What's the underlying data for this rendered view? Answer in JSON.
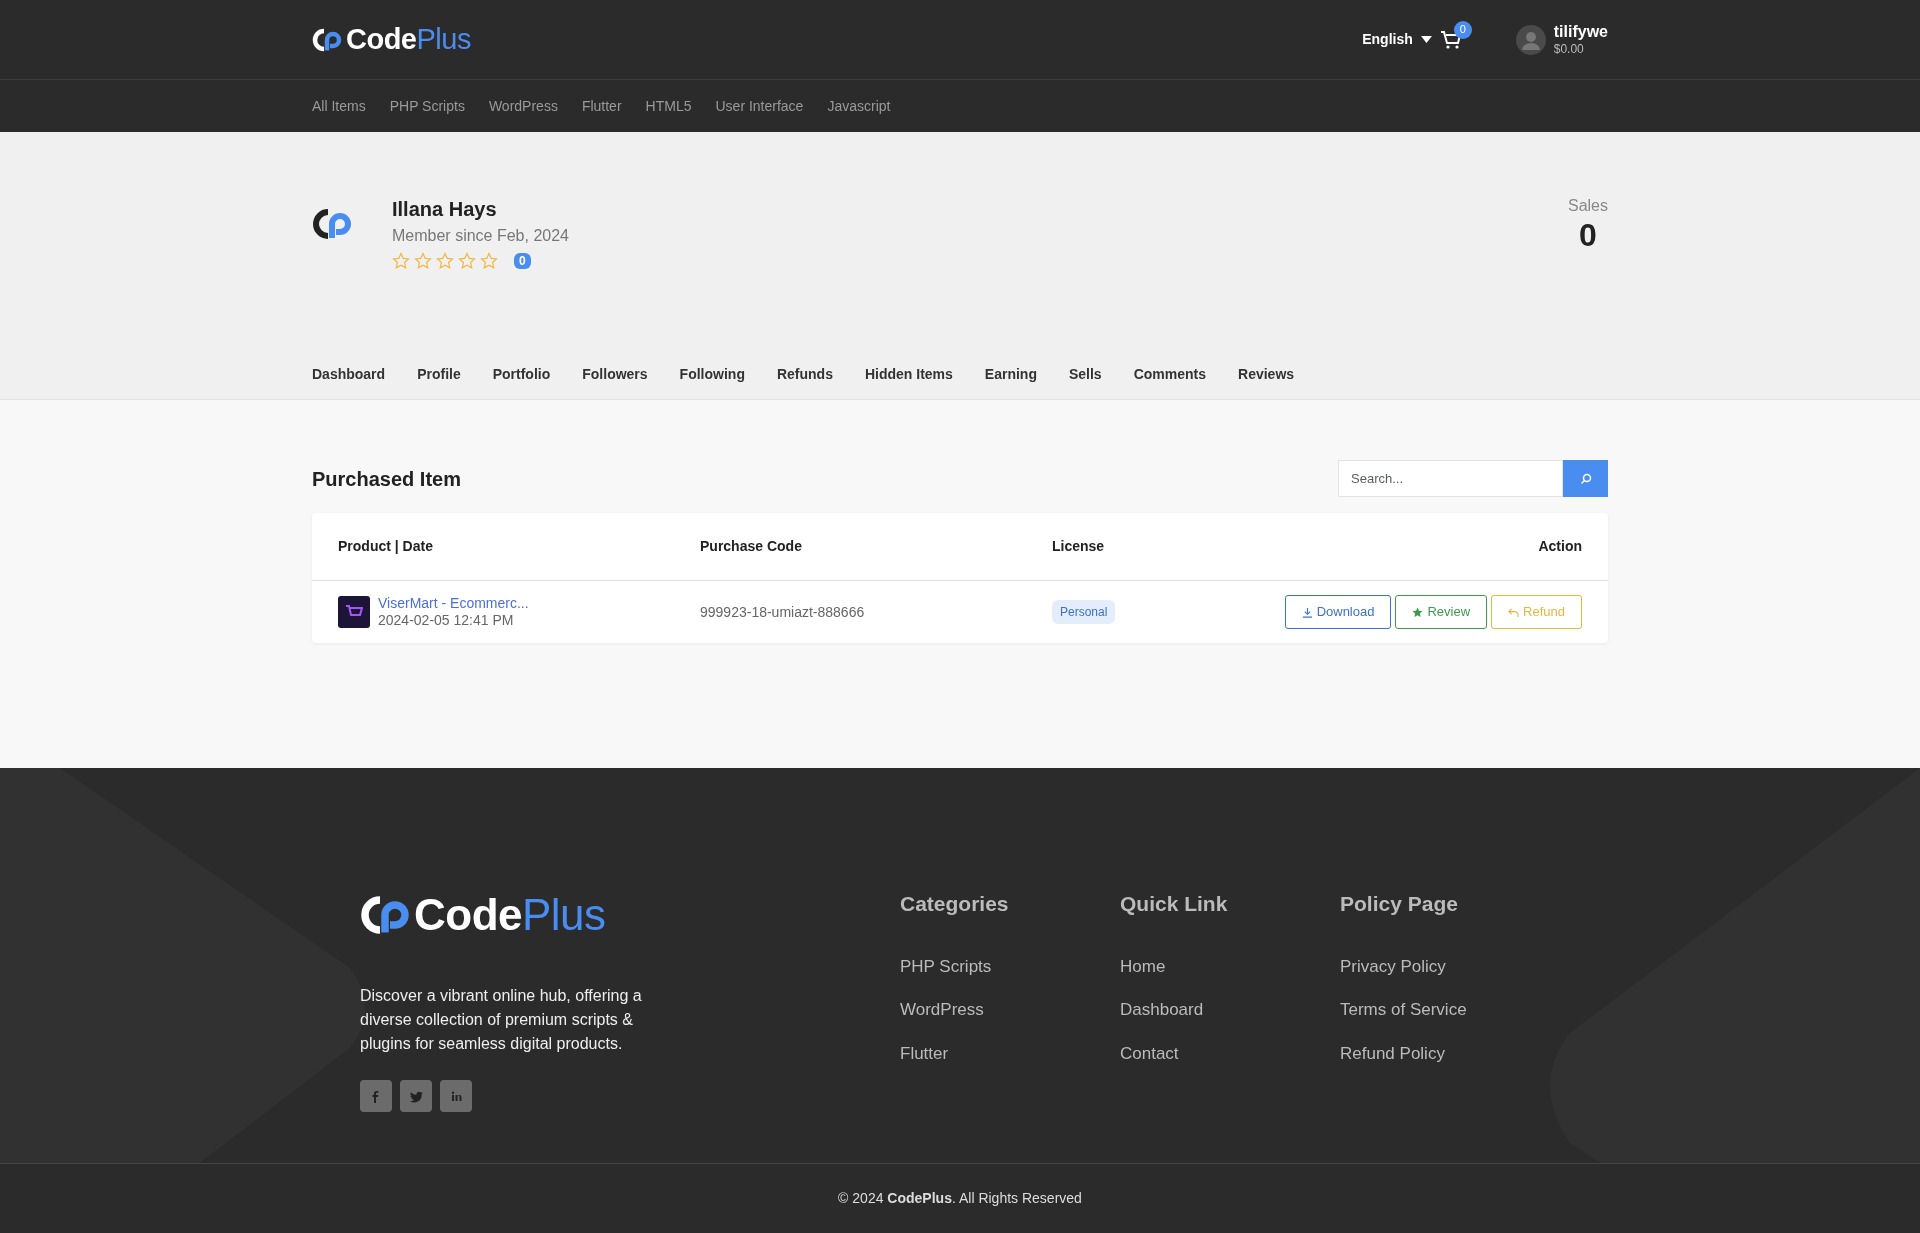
{
  "header": {
    "logo": {
      "bold": "Code",
      "light": "Plus"
    },
    "language": "English",
    "cart_count": "0",
    "user": {
      "name": "tilifywe",
      "balance": "$0.00"
    }
  },
  "categories": [
    "All Items",
    "PHP Scripts",
    "WordPress",
    "Flutter",
    "HTML5",
    "User Interface",
    "Javascript"
  ],
  "profile": {
    "name": "Illana Hays",
    "member_since": "Member since Feb, 2024",
    "stars": 0,
    "rating_count": "0",
    "sales_label": "Sales",
    "sales_value": "0"
  },
  "tabs": [
    "Dashboard",
    "Profile",
    "Portfolio",
    "Followers",
    "Following",
    "Refunds",
    "Hidden Items",
    "Earning",
    "Sells",
    "Comments",
    "Reviews"
  ],
  "purchased": {
    "title": "Purchased Item",
    "search": {
      "placeholder": "Search..."
    },
    "table": {
      "columns": [
        "Product | Date",
        "Purchase Code",
        "License",
        "Action"
      ],
      "rows": [
        {
          "product": "ViserMart - Ecommerc...",
          "date": "2024-02-05 12:41 PM",
          "code": "999923-18-umiazt-888666",
          "license": "Personal",
          "actions": [
            {
              "kind": "download",
              "label": "Download"
            },
            {
              "kind": "review",
              "label": "Review"
            },
            {
              "kind": "refund",
              "label": "Refund"
            }
          ]
        }
      ]
    }
  },
  "footer": {
    "logo": {
      "bold": "Code",
      "light": "Plus"
    },
    "description": "Discover a vibrant online hub, offering a diverse collection of premium scripts & plugins for seamless digital products.",
    "socials": [
      {
        "kind": "facebook"
      },
      {
        "kind": "twitter"
      },
      {
        "kind": "linkedin"
      }
    ],
    "columns": [
      {
        "title": "Categories",
        "links": [
          "PHP Scripts",
          "WordPress",
          "Flutter"
        ]
      },
      {
        "title": "Quick Link",
        "links": [
          "Home",
          "Dashboard",
          "Contact"
        ]
      },
      {
        "title": "Policy Page",
        "links": [
          "Privacy Policy",
          "Terms of Service",
          "Refund Policy"
        ]
      }
    ],
    "copyright": "© 2024 **CodePlus**. All Rights Reserved"
  }
}
